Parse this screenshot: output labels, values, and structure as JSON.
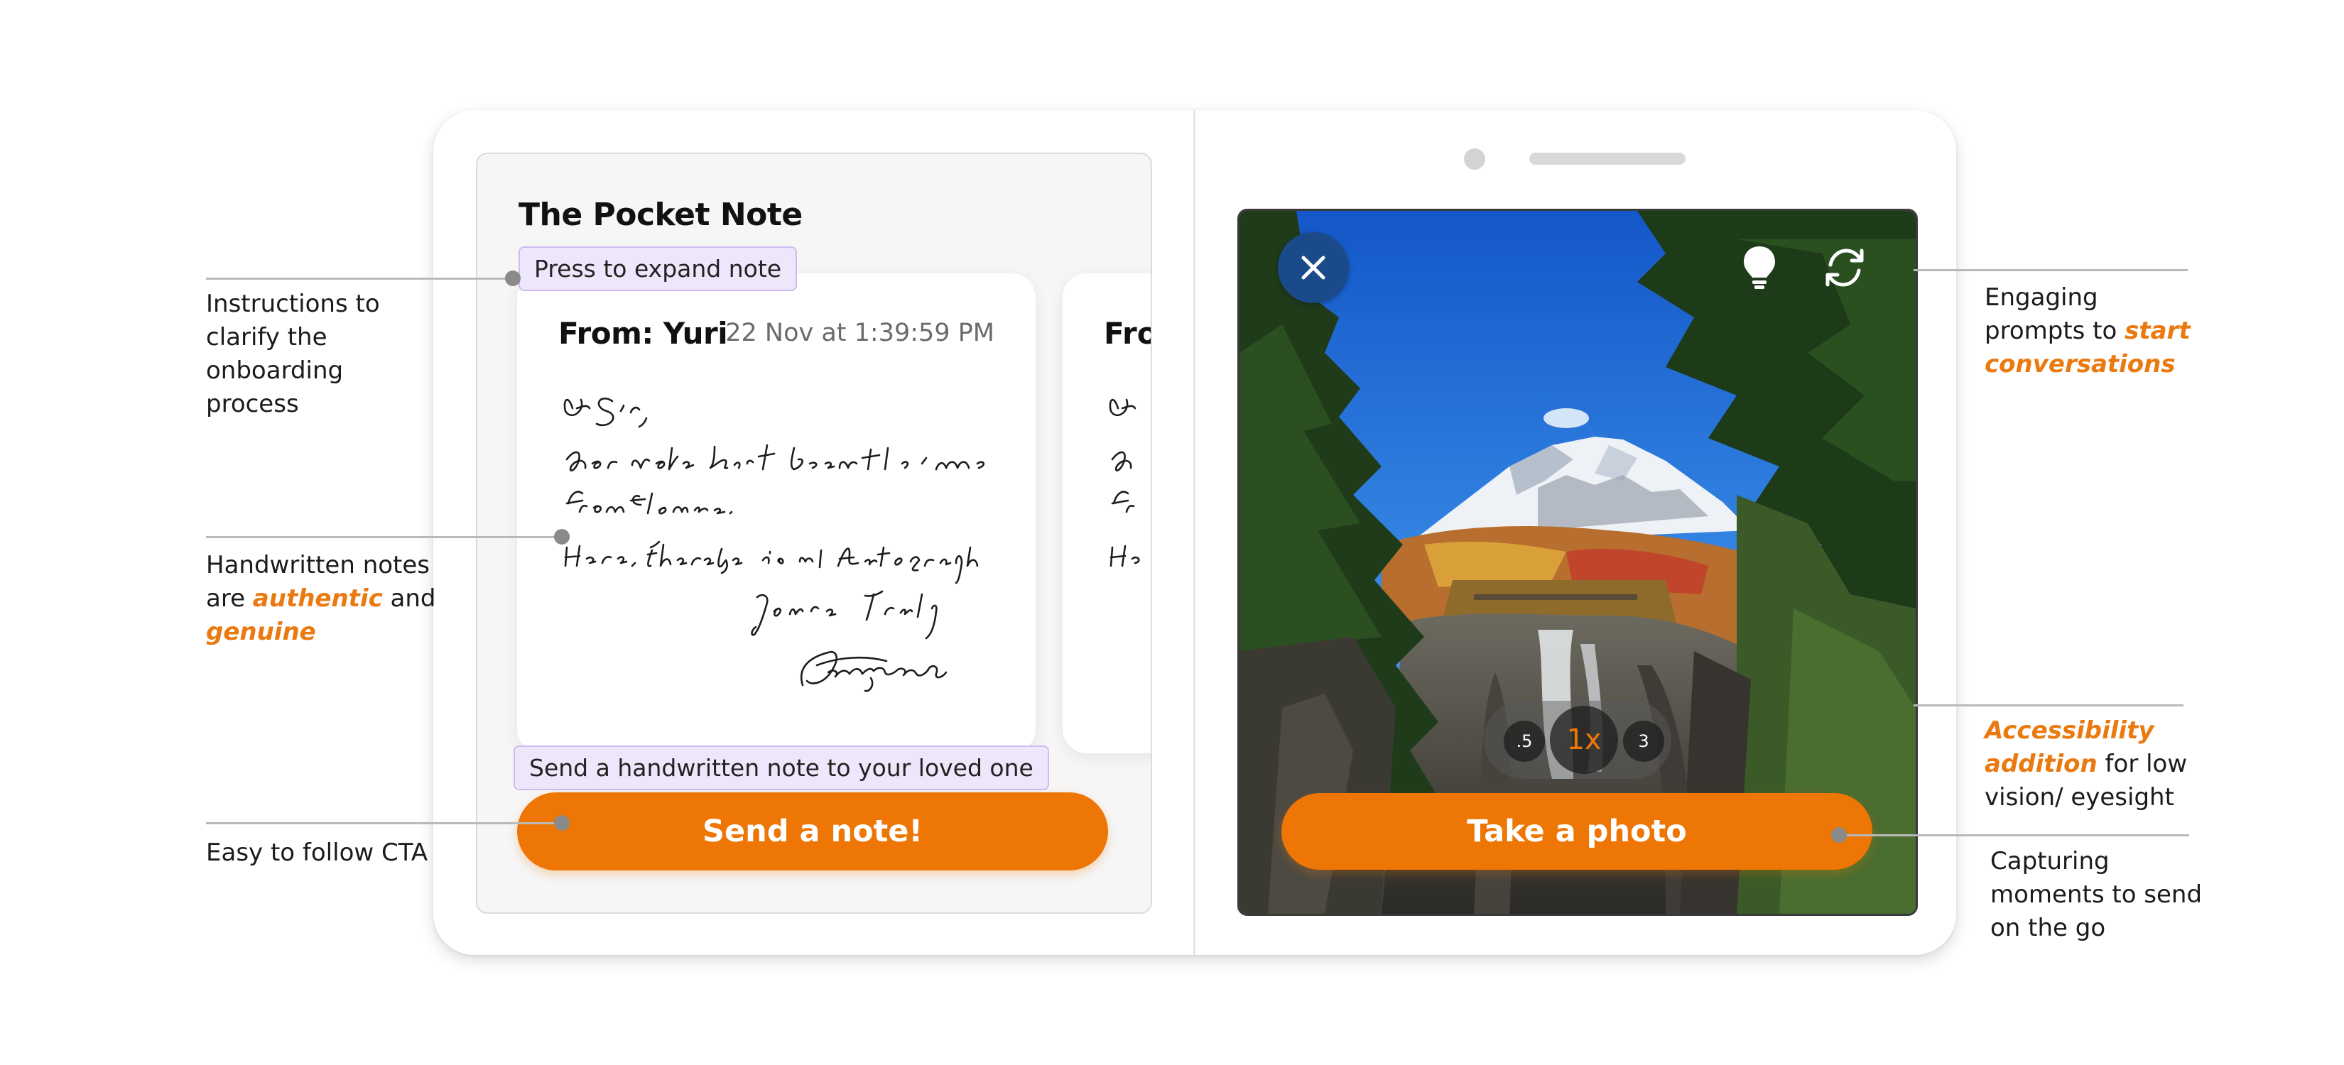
{
  "app": {
    "title": "The Pocket Note"
  },
  "note": {
    "from": "From: Yuri",
    "date": "22 Nov at 1:39:59 PM",
    "next_from": "From: Yuri",
    "handwriting": [
      "Dr Sir,",
      "Your note has just been sent to me",
      "from Florence.",
      "Here, therefore, is an Autograph",
      "Yours Truly",
      "ATennyson"
    ]
  },
  "tooltips": {
    "expand": "Press to expand note",
    "send_hint": "Send a handwritten note to your loved one"
  },
  "buttons": {
    "send_note": "Send a note!",
    "take_photo": "Take a photo"
  },
  "camera": {
    "zoom_options": [
      ".5",
      "1x",
      "3"
    ],
    "selected_zoom": "1x",
    "icons": [
      "close-icon",
      "lightbulb-icon",
      "refresh-icon"
    ]
  },
  "annotations": {
    "onboarding": [
      "Instructions to",
      "clarify the",
      "onboarding",
      "process"
    ],
    "handwritten": {
      "line1": "Handwritten notes",
      "line2_pre": "are ",
      "line2_hl": "authentic",
      "line2_post": " and",
      "line3_hl": "genuine"
    },
    "cta": "Easy to follow CTA",
    "prompts": {
      "line1": "Engaging",
      "line2_pre": "prompts to ",
      "line2_hl": "start",
      "line3_hl": "conversations"
    },
    "accessibility": {
      "line1_hl": "Accessibility",
      "line2_hl": "addition",
      "line2_post": " for low",
      "line3": "vision/ eyesight"
    },
    "capture": [
      "Capturing",
      "moments to send",
      "on the go"
    ]
  },
  "colors": {
    "accent": "#ee7604",
    "highlight_text": "#ea7a10",
    "tooltip_bg": "#eee7fb",
    "tooltip_border": "#cdbcf0"
  }
}
